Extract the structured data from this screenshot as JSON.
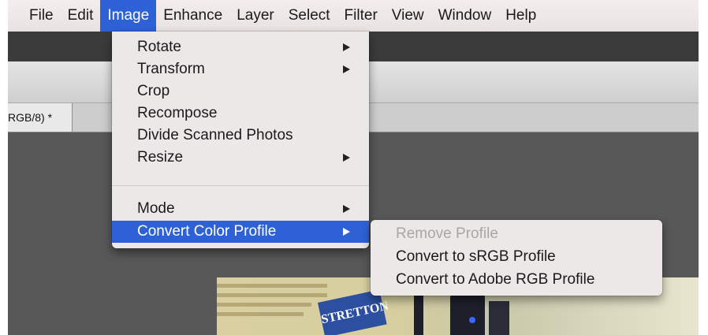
{
  "menubar": {
    "items": [
      "File",
      "Edit",
      "Image",
      "Enhance",
      "Layer",
      "Select",
      "Filter",
      "View",
      "Window",
      "Help"
    ],
    "active_index": 2
  },
  "document_tab": {
    "title": "RGB/8) *"
  },
  "image_menu": {
    "items": [
      {
        "label": "Rotate",
        "has_submenu": true
      },
      {
        "label": "Transform",
        "has_submenu": true
      },
      {
        "label": "Crop",
        "has_submenu": false
      },
      {
        "label": "Recompose",
        "has_submenu": false
      },
      {
        "label": "Divide Scanned Photos",
        "has_submenu": false
      },
      {
        "label": "Resize",
        "has_submenu": true
      },
      {
        "label": "Mode",
        "has_submenu": true
      },
      {
        "label": "Convert Color Profile",
        "has_submenu": true,
        "highlighted": true
      }
    ]
  },
  "convert_color_profile_submenu": {
    "items": [
      {
        "label": "Remove Profile",
        "enabled": false
      },
      {
        "label": "Convert to sRGB Profile",
        "enabled": true
      },
      {
        "label": "Convert to Adobe RGB Profile",
        "enabled": true
      }
    ]
  },
  "photo": {
    "banner_text": "STRETTON"
  },
  "colors": {
    "menu_highlight": "#2e61d6",
    "menu_background": "#ece8e8",
    "menubar_background": "#f1eaea",
    "workspace": "#585858",
    "disabled_text": "#a9a6a6"
  },
  "icons": {
    "submenu_arrow": "triangle-right-icon"
  }
}
